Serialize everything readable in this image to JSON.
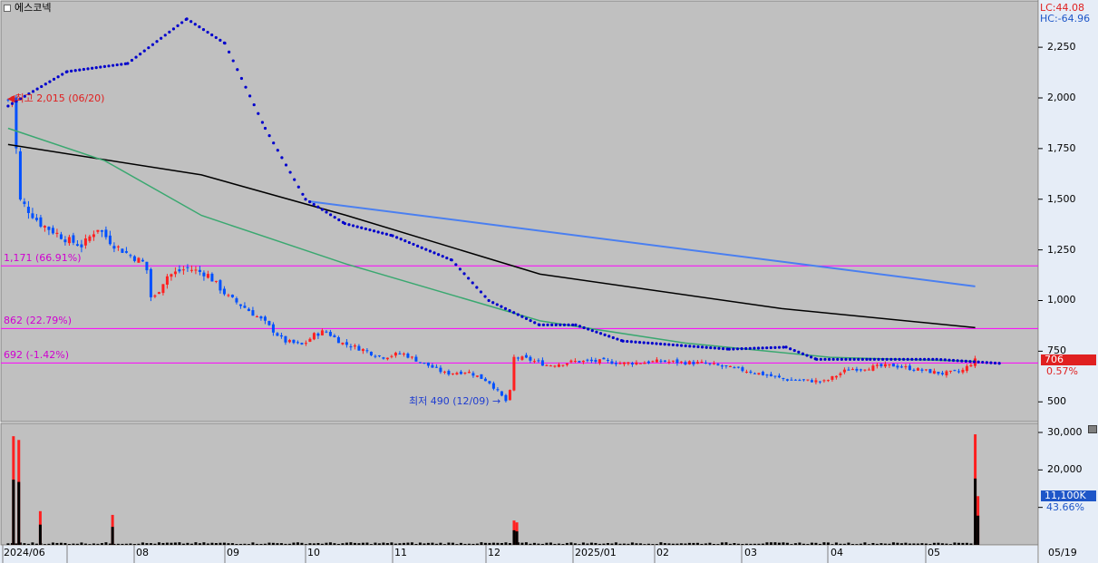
{
  "title": "에스코넥",
  "lc_label": "LC:44.08",
  "hc_label": "HC:-64.96",
  "price_ticks": [
    "2,250",
    "2,000",
    "1,750",
    "1,500",
    "1,250",
    "1,000",
    "750",
    "500"
  ],
  "volume_ticks": [
    "30,000",
    "20,000"
  ],
  "x_ticks": [
    "2024/06",
    "08",
    "09",
    "10",
    "11",
    "12",
    "2025/01",
    "02",
    "03",
    "04",
    "05"
  ],
  "date_readout": "05/19",
  "current_price": "706",
  "current_change": "0.57%",
  "volume_badge": "11,100K",
  "volume_change": "43.66%",
  "annotations": {
    "high": "최고 2,015 (06/20)",
    "low": "최저 490 (12/09)",
    "level_1171": "1,171 (66.91%)",
    "level_862": "862 (22.79%)",
    "level_692": "692 (-1.42%)"
  },
  "colors": {
    "panel_bg": "#c0c0c0",
    "axis_bg": "#e6edf7",
    "up": "#ff2020",
    "down": "#0050ff",
    "ma_black": "#000000",
    "ma_green": "#3aa870",
    "trend_blue": "#4a7ff0",
    "parabolic": "#0000cc",
    "level_line": "#ff00ff",
    "price_badge": "#e02020",
    "volume_badge": "#1e56c8"
  },
  "chart_data": {
    "type": "candlestick",
    "price_range": [
      420,
      2420
    ],
    "volume_range": [
      0,
      31000
    ],
    "months": [
      "2024/06",
      "08",
      "09",
      "10",
      "11",
      "12",
      "2025/01",
      "02",
      "03",
      "04",
      "05"
    ],
    "close_path": [
      {
        "d": "06/19",
        "p": 1990
      },
      {
        "d": "06/20",
        "p": 2015
      },
      {
        "d": "06/21",
        "p": 1500
      },
      {
        "d": "06/25",
        "p": 1380
      },
      {
        "d": "07/01",
        "p": 1300
      },
      {
        "d": "07/08",
        "p": 1270
      },
      {
        "d": "07/15",
        "p": 1360
      },
      {
        "d": "07/22",
        "p": 1280
      },
      {
        "d": "07/29",
        "p": 1230
      },
      {
        "d": "08/05",
        "p": 1180
      },
      {
        "d": "08/07",
        "p": 990
      },
      {
        "d": "08/12",
        "p": 1120
      },
      {
        "d": "08/19",
        "p": 1160
      },
      {
        "d": "08/26",
        "p": 1130
      },
      {
        "d": "09/02",
        "p": 1020
      },
      {
        "d": "09/09",
        "p": 960
      },
      {
        "d": "09/16",
        "p": 890
      },
      {
        "d": "09/23",
        "p": 800
      },
      {
        "d": "09/30",
        "p": 780
      },
      {
        "d": "10/04",
        "p": 830
      },
      {
        "d": "10/08",
        "p": 850
      },
      {
        "d": "10/14",
        "p": 790
      },
      {
        "d": "10/21",
        "p": 760
      },
      {
        "d": "10/28",
        "p": 720
      },
      {
        "d": "11/04",
        "p": 740
      },
      {
        "d": "11/11",
        "p": 690
      },
      {
        "d": "11/18",
        "p": 640
      },
      {
        "d": "11/25",
        "p": 650
      },
      {
        "d": "12/02",
        "p": 600
      },
      {
        "d": "12/09",
        "p": 490
      },
      {
        "d": "12/11",
        "p": 720
      },
      {
        "d": "12/16",
        "p": 710
      },
      {
        "d": "12/23",
        "p": 680
      },
      {
        "d": "01/02",
        "p": 700
      },
      {
        "d": "01/13",
        "p": 700
      },
      {
        "d": "01/20",
        "p": 690
      },
      {
        "d": "02/03",
        "p": 700
      },
      {
        "d": "02/17",
        "p": 690
      },
      {
        "d": "03/04",
        "p": 650
      },
      {
        "d": "03/17",
        "p": 610
      },
      {
        "d": "03/31",
        "p": 600
      },
      {
        "d": "04/07",
        "p": 660
      },
      {
        "d": "04/21",
        "p": 680
      },
      {
        "d": "04/28",
        "p": 660
      },
      {
        "d": "05/07",
        "p": 640
      },
      {
        "d": "05/14",
        "p": 650
      },
      {
        "d": "05/19",
        "p": 706
      }
    ],
    "ma_long_black": [
      [
        0,
        1770
      ],
      [
        0.2,
        1620
      ],
      [
        0.35,
        1420
      ],
      [
        0.55,
        1130
      ],
      [
        0.8,
        960
      ],
      [
        1,
        866
      ]
    ],
    "ma_mid_green": [
      [
        0,
        1850
      ],
      [
        0.1,
        1690
      ],
      [
        0.2,
        1420
      ],
      [
        0.35,
        1180
      ],
      [
        0.55,
        900
      ],
      [
        0.7,
        790
      ],
      [
        0.85,
        720
      ],
      [
        1,
        700
      ]
    ],
    "trend_line_blue": [
      {
        "d": "10/02",
        "p": 1490
      },
      {
        "d": "05/19",
        "p": 1070
      }
    ],
    "parabolic_path": [
      {
        "d": "06/19",
        "p": 1960
      },
      {
        "d": "07/01",
        "p": 2130
      },
      {
        "d": "07/29",
        "p": 2170
      },
      {
        "d": "08/19",
        "p": 2390
      },
      {
        "d": "09/01",
        "p": 2270
      },
      {
        "d": "09/16",
        "p": 1850
      },
      {
        "d": "10/01",
        "p": 1500
      },
      {
        "d": "10/15",
        "p": 1380
      },
      {
        "d": "11/01",
        "p": 1320
      },
      {
        "d": "11/20",
        "p": 1200
      },
      {
        "d": "12/02",
        "p": 1000
      },
      {
        "d": "12/20",
        "p": 880
      },
      {
        "d": "01/02",
        "p": 880
      },
      {
        "d": "01/20",
        "p": 800
      },
      {
        "d": "02/25",
        "p": 760
      },
      {
        "d": "03/17",
        "p": 770
      },
      {
        "d": "03/28",
        "p": 710
      },
      {
        "d": "04/14",
        "p": 710
      },
      {
        "d": "05/05",
        "p": 710
      },
      {
        "d": "05/28",
        "p": 690
      }
    ],
    "levels": [
      1171,
      862,
      692
    ],
    "volume_spikes": [
      {
        "d": "06/20",
        "v": 29000
      },
      {
        "d": "06/21",
        "v": 28000
      },
      {
        "d": "06/25",
        "v": 9000
      },
      {
        "d": "07/22",
        "v": 8000
      },
      {
        "d": "12/11",
        "v": 6500
      },
      {
        "d": "12/12",
        "v": 6000
      },
      {
        "d": "05/19",
        "v": 29500
      },
      {
        "d": "05/20",
        "v": 13000
      }
    ]
  }
}
